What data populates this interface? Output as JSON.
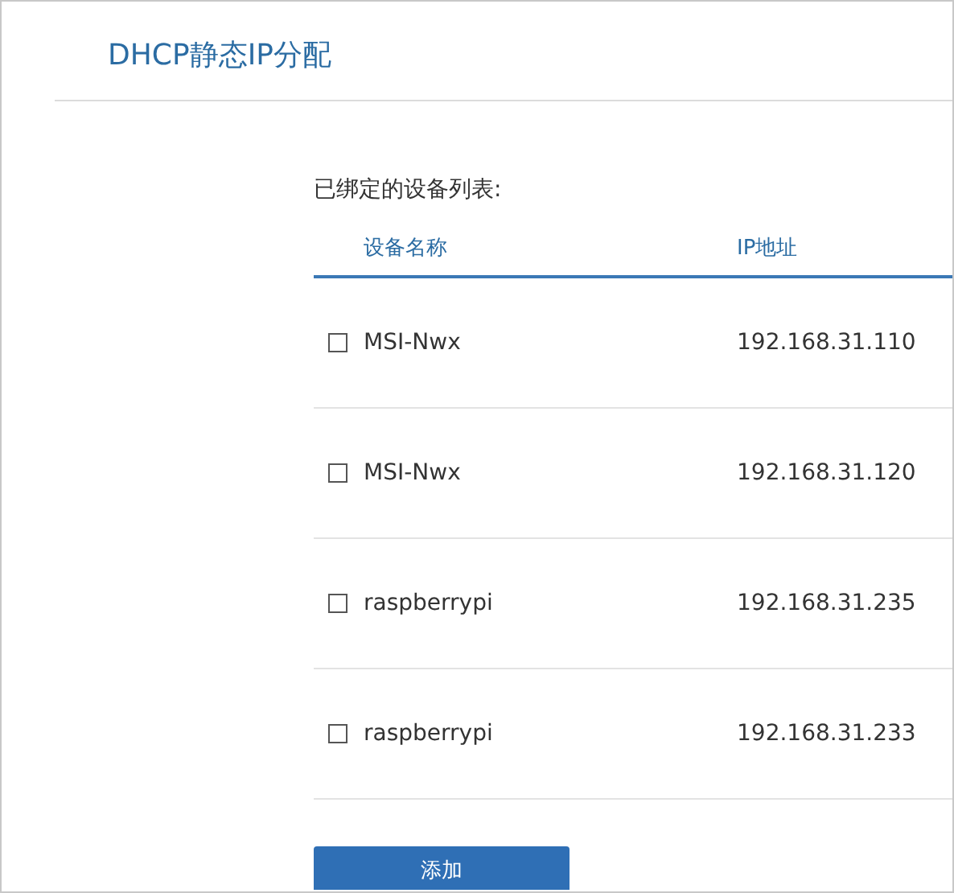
{
  "page": {
    "title": "DHCP静态IP分配"
  },
  "bound_list": {
    "label": "已绑定的设备列表:",
    "columns": [
      "设备名称",
      "IP地址"
    ],
    "rows": [
      {
        "name": "MSI-Nwx",
        "ip": "192.168.31.110",
        "checked": false
      },
      {
        "name": "MSI-Nwx",
        "ip": "192.168.31.120",
        "checked": false
      },
      {
        "name": "raspberrypi",
        "ip": "192.168.31.235",
        "checked": false
      },
      {
        "name": "raspberrypi",
        "ip": "192.168.31.233",
        "checked": false
      }
    ]
  },
  "buttons": [
    "添加"
  ]
}
